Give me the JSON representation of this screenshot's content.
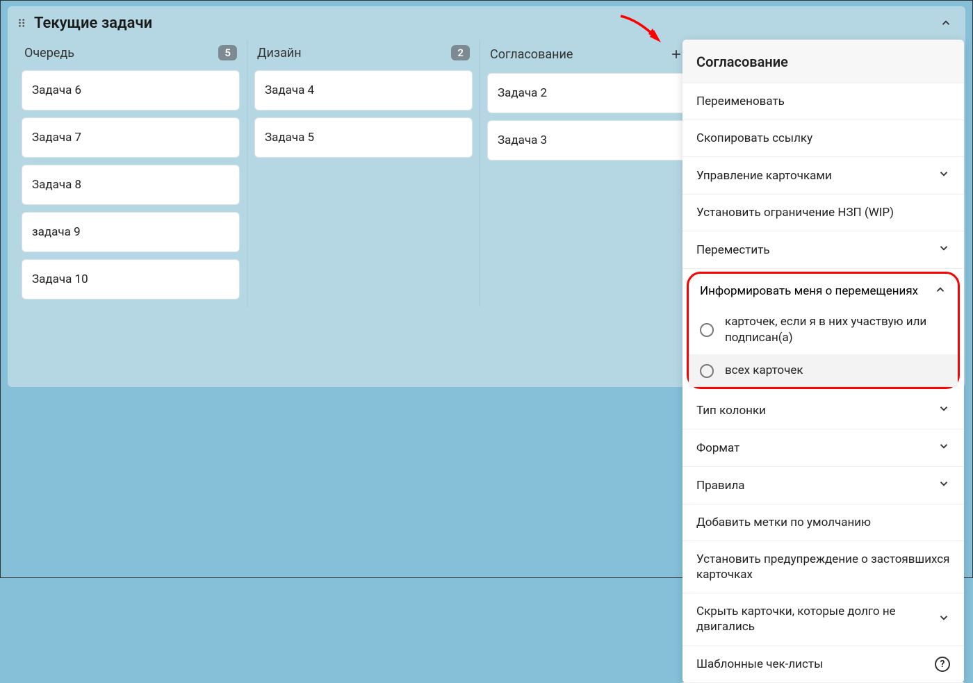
{
  "board": {
    "title": "Текущие задачи",
    "columns": [
      {
        "title": "Очередь",
        "count": "5",
        "show_count": true,
        "cards": [
          "Задача 6",
          "Задача 7",
          "Задача 8",
          "задача 9",
          "Задача 10"
        ]
      },
      {
        "title": "Дизайн",
        "count": "2",
        "show_count": true,
        "cards": [
          "Задача 4",
          "Задача 5"
        ]
      },
      {
        "title": "Согласование",
        "count": "",
        "show_count": false,
        "show_actions": true,
        "cards": [
          "Задача 2",
          "Задача 3"
        ]
      }
    ]
  },
  "menu": {
    "title": "Согласование",
    "items_top": [
      {
        "label": "Переименовать",
        "expand": false
      },
      {
        "label": "Скопировать ссылку",
        "expand": false
      },
      {
        "label": "Управление карточками",
        "expand": true
      },
      {
        "label": "Установить ограничение НЗП (WIP)",
        "expand": false
      },
      {
        "label": "Переместить",
        "expand": true
      }
    ],
    "notify_header": "Информировать меня о перемещениях",
    "notify_opts": [
      "карточек, если я в них участвую или подписан(а)",
      "всех карточек"
    ],
    "items_bottom": [
      {
        "label": "Тип колонки",
        "expand": true
      },
      {
        "label": "Формат",
        "expand": true
      },
      {
        "label": "Правила",
        "expand": true
      },
      {
        "label": "Добавить метки по умолчанию",
        "expand": false
      },
      {
        "label": "Установить предупреждение о застоявшихся карточках",
        "expand": false
      },
      {
        "label": "Скрыть карточки, которые долго не двигались",
        "expand": true
      },
      {
        "label": "Шаблонные чек-листы",
        "expand": false,
        "help": true
      }
    ]
  }
}
